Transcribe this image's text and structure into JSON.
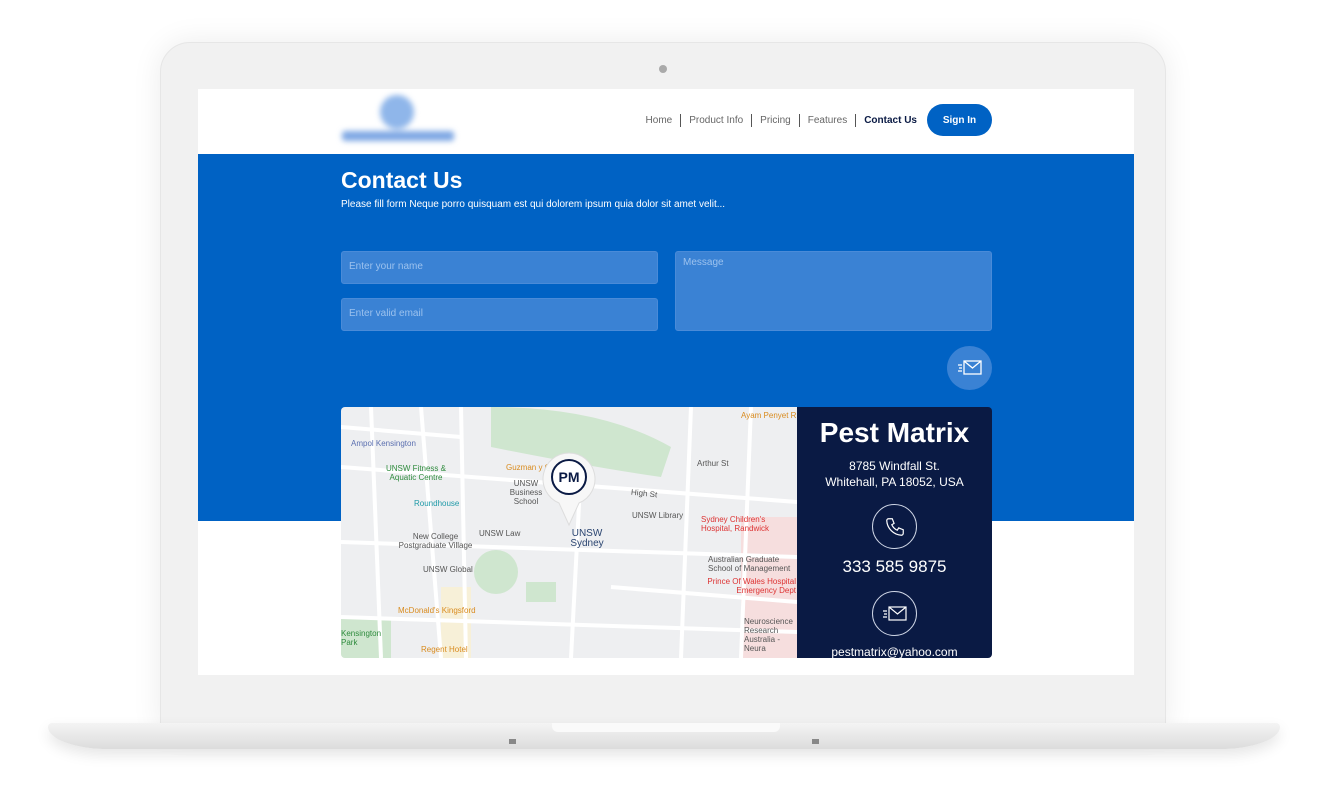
{
  "nav": {
    "items": [
      "Home",
      "Product Info",
      "Pricing",
      "Features",
      "Contact Us"
    ],
    "active": "Contact Us",
    "sign_in": "Sign In"
  },
  "hero": {
    "title": "Contact Us",
    "subtitle": "Please fill form Neque porro quisquam est qui dolorem ipsum quia dolor sit amet velit..."
  },
  "form": {
    "name_placeholder": "Enter your name",
    "email_placeholder": "Enter valid email",
    "message_placeholder": "Message",
    "send_icon": "send-mail-icon"
  },
  "map": {
    "labels": [
      "Ampol Kensington",
      "UNSW Fitness & Aquatic Centre",
      "Guzman y Gomez",
      "UNSW Business School",
      "Roundhouse",
      "UNSW Law",
      "New College Postgraduate Village",
      "UNSW Sydney",
      "UNSW Library",
      "High St",
      "Arthur St",
      "Ayam Penyet RI",
      "Sydney Children's Hospital, Randwick",
      "Australian Graduate School of Management",
      "Prince Of Wales Hospital Emergency Dept",
      "UNSW Global",
      "McDonald's Kingsford",
      "Regent Hotel",
      "Neuroscience Research Australia - Neura",
      "Kensington Park"
    ],
    "marker": "PM"
  },
  "contact": {
    "company": "Pest Matrix",
    "address_line1": "8785 Windfall St.",
    "address_line2": "Whitehall, PA 18052, USA",
    "phone": "333 585 9875",
    "email": "pestmatrix@yahoo.com"
  },
  "colors": {
    "brand": "#0062c4",
    "dark": "#0a1a44"
  }
}
